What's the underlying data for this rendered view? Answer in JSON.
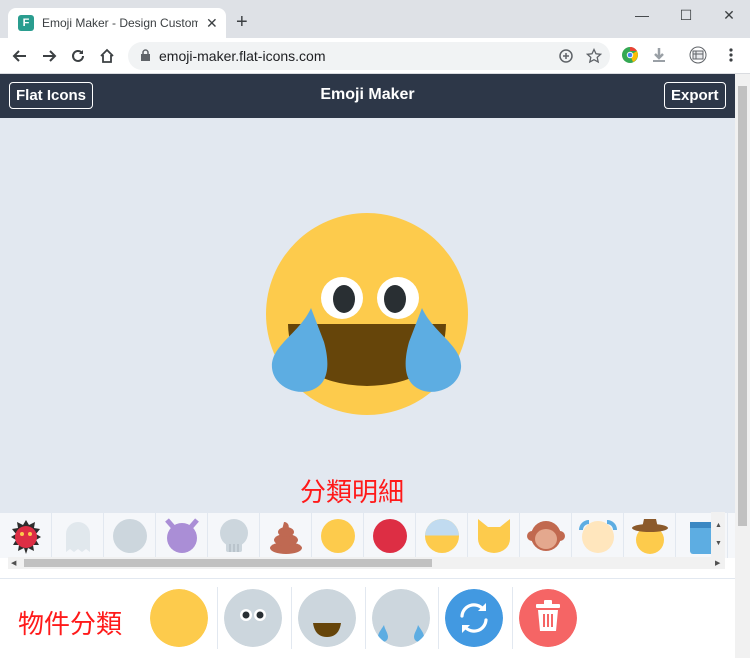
{
  "browser": {
    "tab_title": "Emoji Maker - Design Custom E",
    "tab_close": "✕",
    "new_tab": "+",
    "url": "emoji-maker.flat-icons.com",
    "favicon_letter": "F",
    "window": {
      "minimize": "—",
      "maximize": "☐",
      "close": "✕"
    }
  },
  "app": {
    "title": "Emoji Maker",
    "brand_button": "Flat Icons",
    "export_button": "Export"
  },
  "annotations": {
    "items_detail": "分類明細",
    "categories": "物件分類"
  },
  "items": [
    "red-spiky-face",
    "ghost",
    "plain-gray-face",
    "purple-devil",
    "skull",
    "poop",
    "yellow-face",
    "red-face",
    "half-blue-face",
    "cat-face",
    "monkey-face",
    "blonde-hair-face",
    "cowboy-face",
    "blue-robot-face"
  ],
  "categories": [
    "base-face",
    "eyes",
    "mouth",
    "tears",
    "randomize",
    "delete"
  ],
  "colors": {
    "header": "#2d3748",
    "canvas": "#e2e8f0",
    "face": "#fdcb4c",
    "tear": "#5dade2",
    "mouth": "#66450a",
    "randomize": "#4299e1",
    "delete": "#f56565",
    "annotation": "#ff1a1a"
  }
}
